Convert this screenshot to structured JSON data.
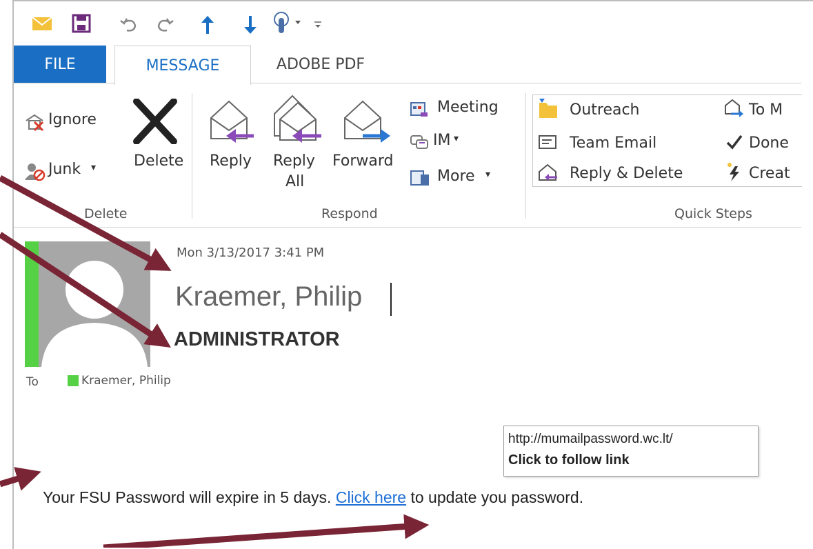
{
  "colors": {
    "accent": "#1a6fc4",
    "arrow": "#7a2535",
    "presence": "#56d145",
    "link": "#1f6fd6"
  },
  "qat": {
    "icons": [
      "mail-icon",
      "save-icon",
      "undo-icon",
      "redo-icon",
      "up-arrow-icon",
      "down-arrow-icon",
      "touch-mode-icon",
      "customize-icon"
    ]
  },
  "tabs": {
    "file": "FILE",
    "message": "MESSAGE",
    "adobe": "ADOBE PDF"
  },
  "ribbon": {
    "delete_group": {
      "ignore": "Ignore",
      "junk": "Junk",
      "delete": "Delete",
      "label": "Delete"
    },
    "respond_group": {
      "reply": "Reply",
      "reply_all_1": "Reply",
      "reply_all_2": "All",
      "forward": "Forward",
      "meeting": "Meeting",
      "im": "IM",
      "more": "More",
      "label": "Respond"
    },
    "quick_steps": {
      "outreach": "Outreach",
      "team_email": "Team Email",
      "reply_delete": "Reply & Delete",
      "to_manager": "To M",
      "done": "Done",
      "create_new": "Creat",
      "label": "Quick Steps"
    }
  },
  "message": {
    "date": "Mon 3/13/2017 3:41 PM",
    "sender": "Kraemer, Philip",
    "title": "ADMINISTRATOR",
    "to_label": "To",
    "to_name": "Kraemer, Philip",
    "tooltip_url": "http://mumailpassword.wc.lt/",
    "tooltip_action": "Click to follow link",
    "body_before": "Your FSU Password will expire in 5 days. ",
    "body_link": "Click here",
    "body_after": " to update you password."
  }
}
